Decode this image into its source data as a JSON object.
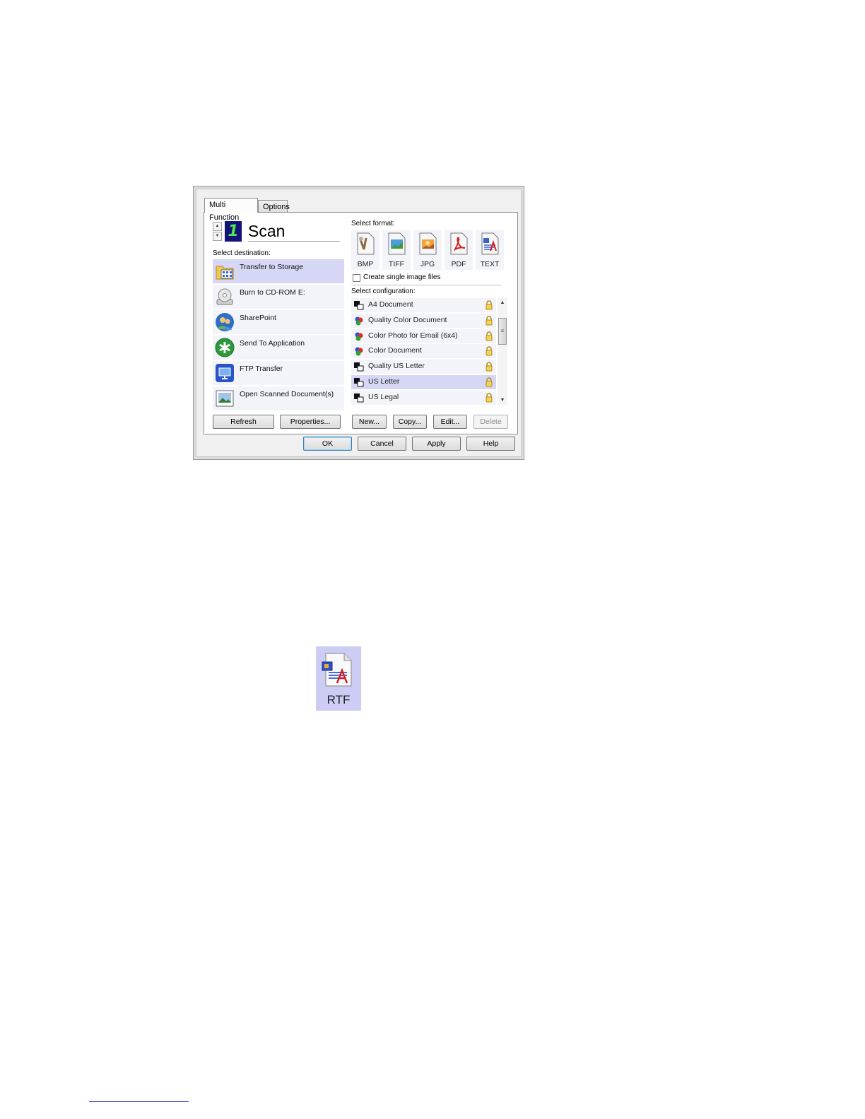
{
  "tabs": [
    {
      "label": "Multi Function",
      "active": true
    },
    {
      "label": "Options",
      "active": false
    }
  ],
  "profile": {
    "number": "1",
    "name": "Scan"
  },
  "destination": {
    "label": "Select destination:",
    "items": [
      {
        "label": "Transfer to Storage",
        "icon": "folder-storage-icon",
        "selected": true
      },
      {
        "label": "Burn to CD-ROM  E:",
        "icon": "cd-drive-icon",
        "selected": false
      },
      {
        "label": "SharePoint",
        "icon": "sharepoint-icon",
        "selected": false
      },
      {
        "label": "Send To Application",
        "icon": "application-icon",
        "selected": false
      },
      {
        "label": "FTP Transfer",
        "icon": "ftp-icon",
        "selected": false
      },
      {
        "label": "Open Scanned Document(s)",
        "icon": "open-document-icon",
        "selected": false
      }
    ]
  },
  "format": {
    "label": "Select format:",
    "items": [
      {
        "label": "BMP",
        "icon": "bmp-icon"
      },
      {
        "label": "TIFF",
        "icon": "tiff-icon"
      },
      {
        "label": "JPG",
        "icon": "jpg-icon"
      },
      {
        "label": "PDF",
        "icon": "pdf-icon"
      },
      {
        "label": "TEXT",
        "icon": "text-icon"
      }
    ],
    "single_image_label": "Create single image files",
    "single_image_checked": false
  },
  "configuration": {
    "label": "Select configuration:",
    "items": [
      {
        "label": "A4 Document",
        "icon": "bw-document-icon",
        "selected": false
      },
      {
        "label": "Quality Color Document",
        "icon": "color-document-icon",
        "selected": false
      },
      {
        "label": "Color Photo for Email (6x4)",
        "icon": "color-document-icon",
        "selected": false
      },
      {
        "label": "Color Document",
        "icon": "color-document-icon",
        "selected": false
      },
      {
        "label": "Quality US Letter",
        "icon": "bw-document-icon",
        "selected": false
      },
      {
        "label": "US Letter",
        "icon": "bw-document-icon",
        "selected": true
      },
      {
        "label": "US Legal",
        "icon": "bw-document-icon",
        "selected": false
      }
    ]
  },
  "buttons": {
    "refresh": "Refresh",
    "properties": "Properties...",
    "new": "New...",
    "copy": "Copy...",
    "edit": "Edit...",
    "delete": "Delete",
    "ok": "OK",
    "cancel": "Cancel",
    "apply": "Apply",
    "help": "Help"
  },
  "rtf_icon": {
    "label": "RTF",
    "icon": "rtf-format-icon"
  },
  "colors": {
    "selection": "#d6d6f5",
    "item_background": "#f3f3fa",
    "rtf_background": "#cdccf5"
  }
}
